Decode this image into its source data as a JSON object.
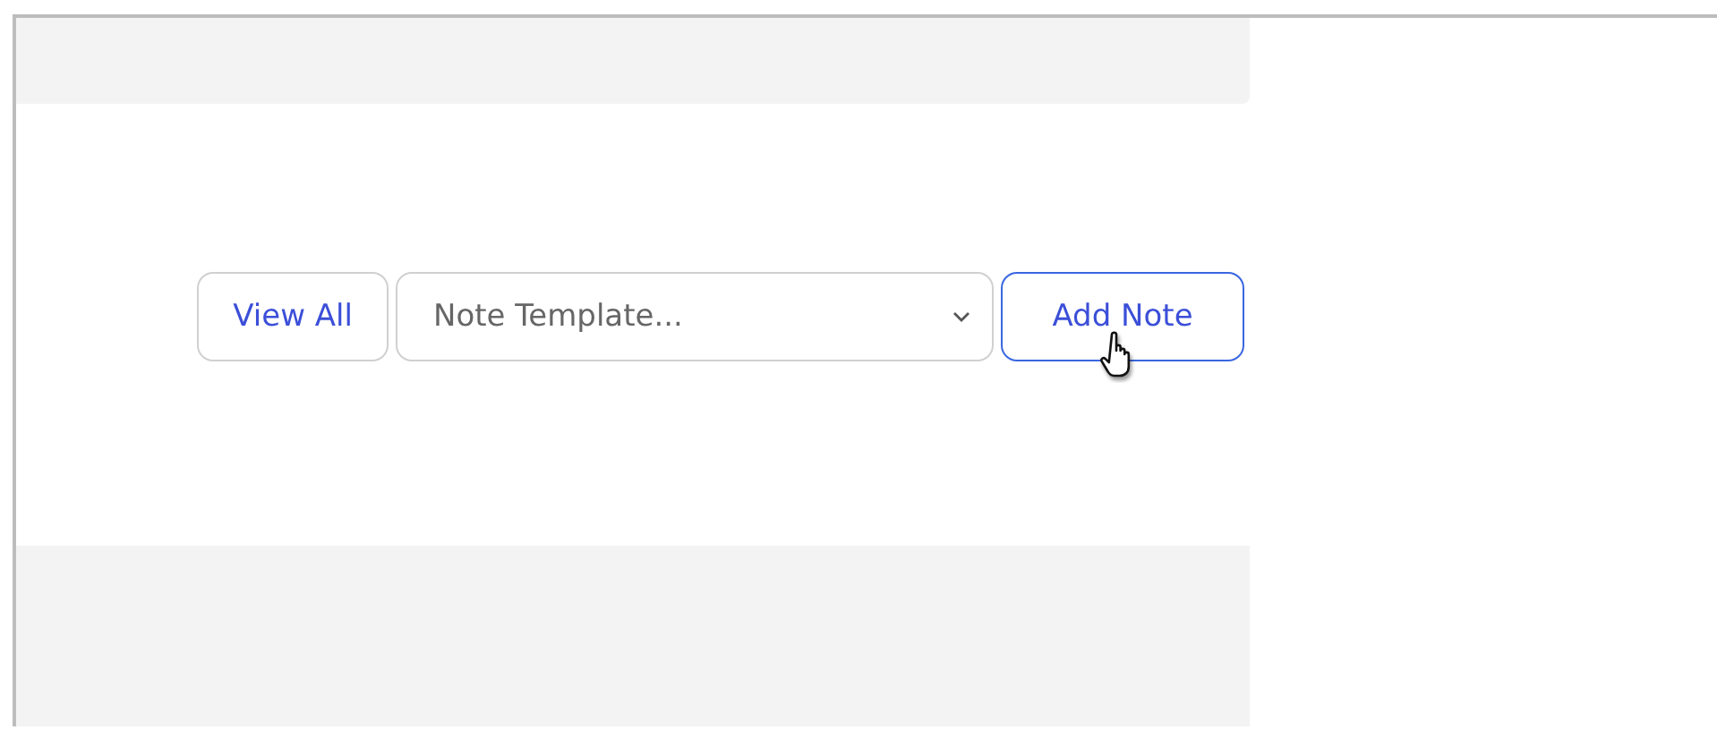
{
  "toolbar": {
    "view_all_button": {
      "label": "View All"
    },
    "template_select": {
      "value": "Note Template..."
    },
    "add_note_button": {
      "label": "Add Note",
      "focused": true
    }
  }
}
